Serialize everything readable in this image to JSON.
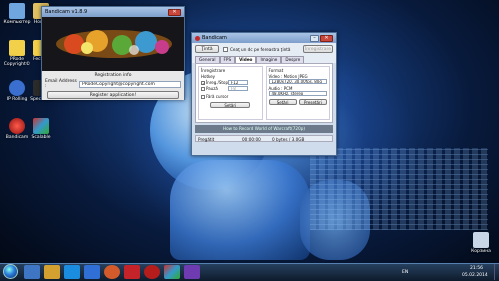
{
  "desktop_icons": [
    {
      "label": "Компьютер",
      "color": "#6fa6e0"
    },
    {
      "label": "Новая",
      "color": "#e0c060"
    },
    {
      "label": "PRode Copyright©",
      "color": "#f2d04a"
    },
    {
      "label": "Fecebo",
      "color": "#f2d04a"
    },
    {
      "label": "IP Rolling",
      "color": "#3a6fcf"
    },
    {
      "label": "Spectrum",
      "color": "#2b2b2b"
    },
    {
      "label": "Bandicam",
      "color": "#c62828"
    },
    {
      "label": "Scalable",
      "color": "#6a4aa5"
    },
    {
      "label": "Корзина",
      "color": "#c8d6e8"
    }
  ],
  "keygen": {
    "title": "Bandicam v1.8.9",
    "reg_info_label": "Registration info",
    "email_label": "Email Address :",
    "email_value": "PRodeCopyright@copyright.com",
    "register_button": "Register application!"
  },
  "bandicam": {
    "title": "Bandicam",
    "target_button": "Ţintă",
    "follow_checkbox": "Ceaţ un dc pe fereastra ţintă",
    "disabled_button": "Înregistrare",
    "tabs": [
      "General",
      "FPS",
      "Video",
      "Imagine",
      "Despre"
    ],
    "active_tab": "Video",
    "record_group": "Înregistrare",
    "hotkey_label": "Hotkey",
    "rec_stop_label": "Înreg./Stop",
    "rec_stop_key": "F12",
    "pause_label": "Pauză",
    "pause_key": "F8",
    "cursor_label": "Fără cursor",
    "record_settings_button": "Setări",
    "format_group": "Format",
    "video_header": "Video : Motion JPEG",
    "video_detail": "1280x720, 30.00fps, 80q",
    "audio_header": "Audio : PCM",
    "audio_detail": "48.0KHz, stereo",
    "format_settings_button": "Setări",
    "presets_button": "Presetări",
    "window_caption": "How to Record World of Warcraft(720p)",
    "status_state": "Pregătit",
    "status_time": "00:00:00",
    "status_size": "0 bytes / 3.0GB"
  },
  "taskbar": {
    "lang": "EN",
    "time": "21:56",
    "date": "05.02.2014"
  }
}
